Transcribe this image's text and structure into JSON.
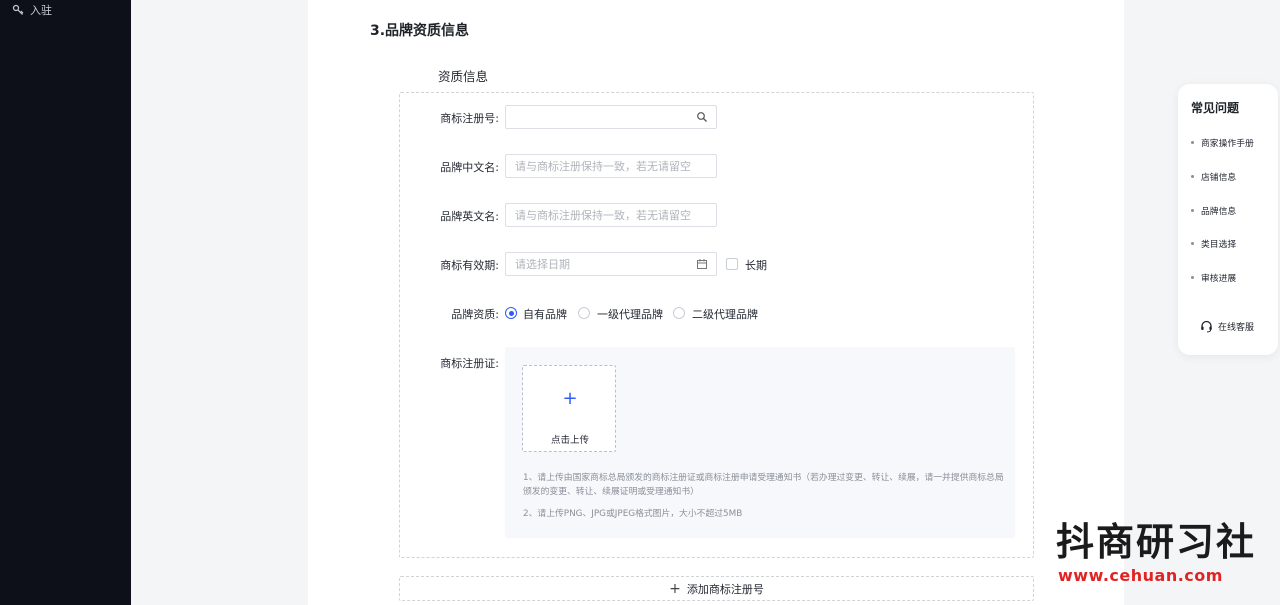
{
  "sidebar": {
    "items": [
      {
        "label": "入驻",
        "icon": "key-icon"
      }
    ]
  },
  "section": {
    "title": "3.品牌资质信息",
    "subtitle": "资质信息"
  },
  "form": {
    "trademark_no": {
      "label": "商标注册号:",
      "value": "",
      "icon": "search-icon"
    },
    "brand_cn": {
      "label": "品牌中文名:",
      "placeholder": "请与商标注册保持一致，若无请留空"
    },
    "brand_en": {
      "label": "品牌英文名:",
      "placeholder": "请与商标注册保持一致，若无请留空"
    },
    "validity": {
      "label": "商标有效期:",
      "placeholder": "请选择日期",
      "icon": "calendar-icon",
      "long_term_label": "长期",
      "long_term_checked": false
    },
    "qualification": {
      "label": "品牌资质:",
      "options": [
        "自有品牌",
        "一级代理品牌",
        "二级代理品牌"
      ],
      "selected": "自有品牌"
    },
    "certificate": {
      "label": "商标注册证:",
      "upload_text": "点击上传",
      "notes": [
        "1、请上传由国家商标总局颁发的商标注册证或商标注册申请受理通知书（若办理过变更、转让、续展，请一并提供商标总局颁发的变更、转让、续展证明或受理通知书）",
        "2、请上传PNG、JPG或JPEG格式图片，大小不超过5MB"
      ]
    },
    "add_trademark_label": "添加商标注册号"
  },
  "faq": {
    "title": "常见问题",
    "items": [
      "商家操作手册",
      "店铺信息",
      "品牌信息",
      "类目选择",
      "审核进展"
    ],
    "service_label": "在线客服",
    "service_icon": "headset-icon"
  },
  "watermark": {
    "title": "抖商研习社",
    "url": "www.cehuan.com"
  },
  "colors": {
    "accent": "#2f5cf6",
    "sidebar_bg": "#0e1019",
    "watermark_red": "#e02424"
  }
}
